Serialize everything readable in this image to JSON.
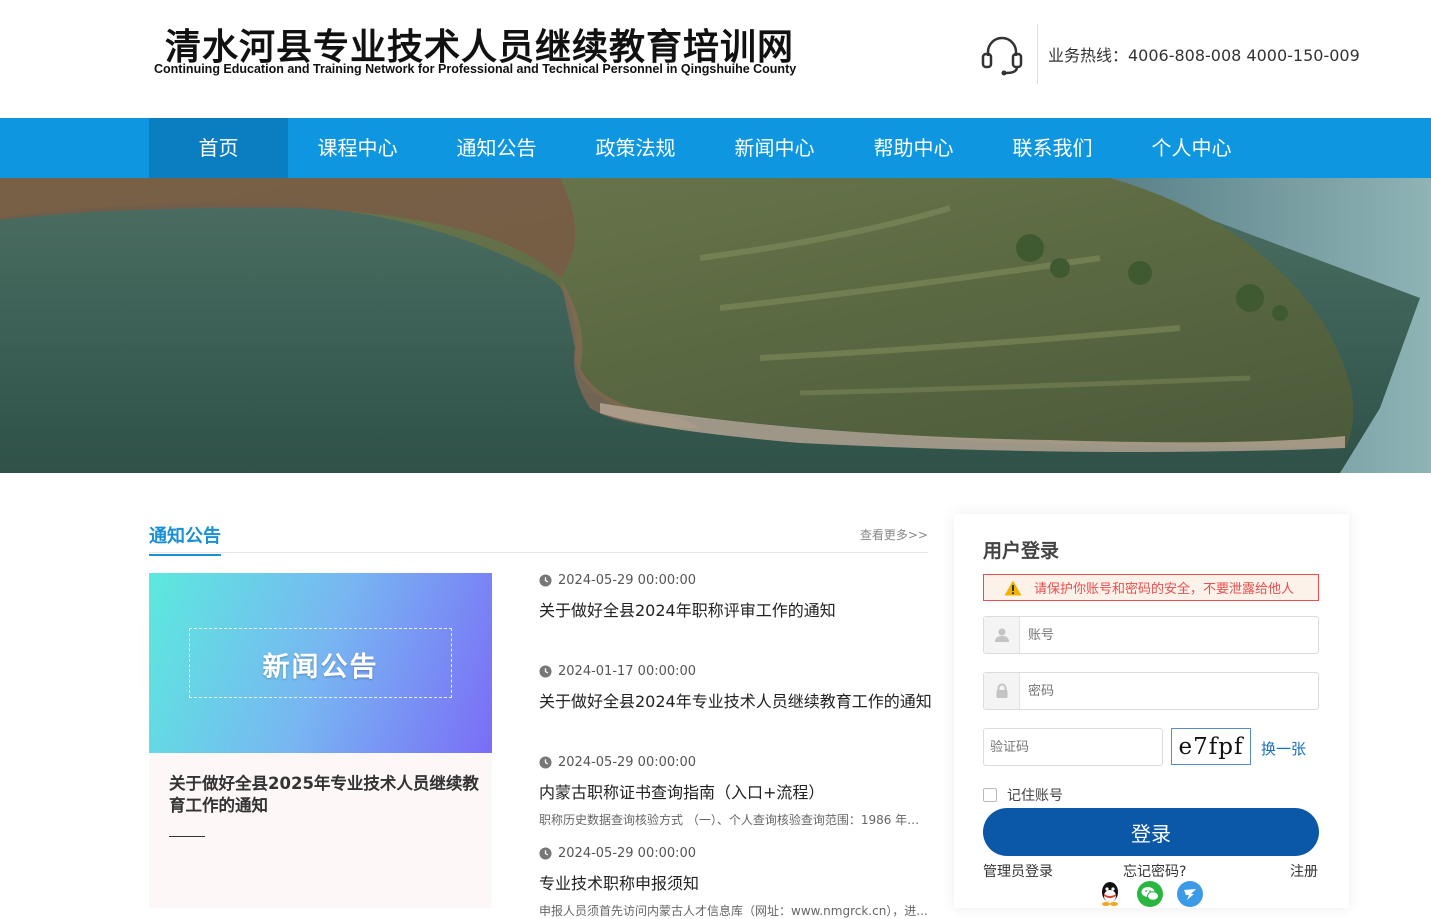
{
  "header": {
    "title": "清水河县专业技术人员继续教育培训网",
    "subtitle": "Continuing Education and Training Network for Professional and Technical Personnel in Qingshuihe County",
    "hotline": "业务热线：4006-808-008 4000-150-009"
  },
  "nav": {
    "items": [
      "首页",
      "课程中心",
      "通知公告",
      "政策法规",
      "新闻中心",
      "帮助中心",
      "联系我们",
      "个人中心"
    ],
    "active": "首页"
  },
  "notices": {
    "section_title": "通知公告",
    "more": "查看更多>>",
    "feature": {
      "image_text": "新闻公告",
      "title": "关于做好全县2025年专业技术人员继续教育工作的通知"
    },
    "items": [
      {
        "date": "2024-05-29 00:00:00",
        "title": "关于做好全县2024年职称评审工作的通知",
        "summary": ""
      },
      {
        "date": "2024-01-17 00:00:00",
        "title": "关于做好全县2024年专业技术人员继续教育工作的通知",
        "summary": ""
      },
      {
        "date": "2024-05-29 00:00:00",
        "title": "内蒙古职称证书查询指南（入口+流程）",
        "summary": "职称历史数据查询核验方式 （一）、个人查询核验查询范围：1986 年至..."
      },
      {
        "date": "2024-05-29 00:00:00",
        "title": "专业技术职称申报须知",
        "summary": "申报人员须首先访问内蒙古人才信息库（网址：www.nmgrck.cn），进..."
      }
    ]
  },
  "login": {
    "title": "用户登录",
    "warning": "请保护你账号和密码的安全，不要泄露给他人",
    "account_placeholder": "账号",
    "password_placeholder": "密码",
    "captcha_placeholder": "验证码",
    "captcha_text": "e7fpf",
    "refresh": "换一张",
    "remember": "记住账号",
    "submit": "登录",
    "admin_login": "管理员登录",
    "forgot": "忘记密码?",
    "register": "注册",
    "social": [
      "qq-icon",
      "wechat-icon",
      "dingtalk-icon"
    ]
  },
  "colors": {
    "nav_bg": "#0e97e0",
    "nav_active": "#0b7ec1",
    "accent": "#1a8fd6",
    "login_button": "#0b57a8",
    "warning": "#e94f4f"
  }
}
